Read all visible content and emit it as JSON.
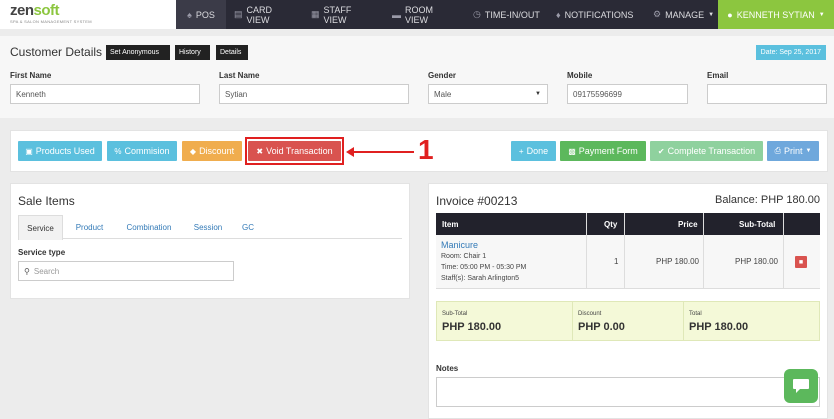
{
  "nav": {
    "logo_main_a": "zen",
    "logo_main_b": "soft",
    "logo_tag": "SPA & SALON MANAGEMENT SYSTEM",
    "items": [
      {
        "label": "POS",
        "icon": "user-group-icon"
      },
      {
        "label": "CARD VIEW",
        "icon": "card-icon"
      },
      {
        "label": "STAFF VIEW",
        "icon": "calendar-icon"
      },
      {
        "label": "ROOM VIEW",
        "icon": "bed-icon"
      },
      {
        "label": "TIME-IN/OUT",
        "icon": "clock-icon"
      },
      {
        "label": "NOTIFICATIONS",
        "icon": "bell-icon"
      },
      {
        "label": "MANAGE",
        "icon": "gear-icon"
      }
    ],
    "user": "KENNETH SYTIAN"
  },
  "customer": {
    "title": "Customer Details",
    "buttons": [
      "Set Anonymous",
      "History",
      "Details"
    ],
    "date": "Date: Sep 25, 2017",
    "fields": {
      "first_name_label": "First Name",
      "first_name": "Kenneth",
      "last_name_label": "Last Name",
      "last_name": "Sytian",
      "gender_label": "Gender",
      "gender": "Male",
      "mobile_label": "Mobile",
      "mobile": "09175596699",
      "email_label": "Email",
      "email": ""
    }
  },
  "actions": {
    "products_used": "Products Used",
    "commision": "Commision",
    "discount": "Discount",
    "void": "Void Transaction",
    "done": "Done",
    "payment_form": "Payment Form",
    "complete": "Complete Transaction",
    "print": "Print"
  },
  "callout": "1",
  "sale": {
    "title": "Sale Items",
    "tabs": [
      "Service",
      "Product",
      "Combination",
      "Session",
      "GC"
    ],
    "service_type_label": "Service type",
    "search_placeholder": "Search"
  },
  "invoice": {
    "title": "Invoice #00213",
    "balance": "Balance: PHP 180.00",
    "headers": [
      "Item",
      "Qty",
      "Price",
      "Sub-Total"
    ],
    "item": {
      "name": "Manicure",
      "room": "Room: Chair 1",
      "time": "Time: 05:00 PM - 05:30 PM",
      "staff": "Staff(s): Sarah Arlington5",
      "qty": "1",
      "price": "PHP 180.00",
      "subtotal": "PHP 180.00"
    },
    "totals": {
      "subtotal_label": "Sub-Total",
      "subtotal": "PHP 180.00",
      "discount_label": "Discount",
      "discount": "PHP 0.00",
      "total_label": "Total",
      "total": "PHP 180.00"
    },
    "notes_label": "Notes",
    "notes_value": ""
  },
  "colors": {
    "accent_green": "#8cc63f",
    "nav_dark": "#2a2a36",
    "danger": "#d9534f",
    "info": "#5bc0de"
  }
}
